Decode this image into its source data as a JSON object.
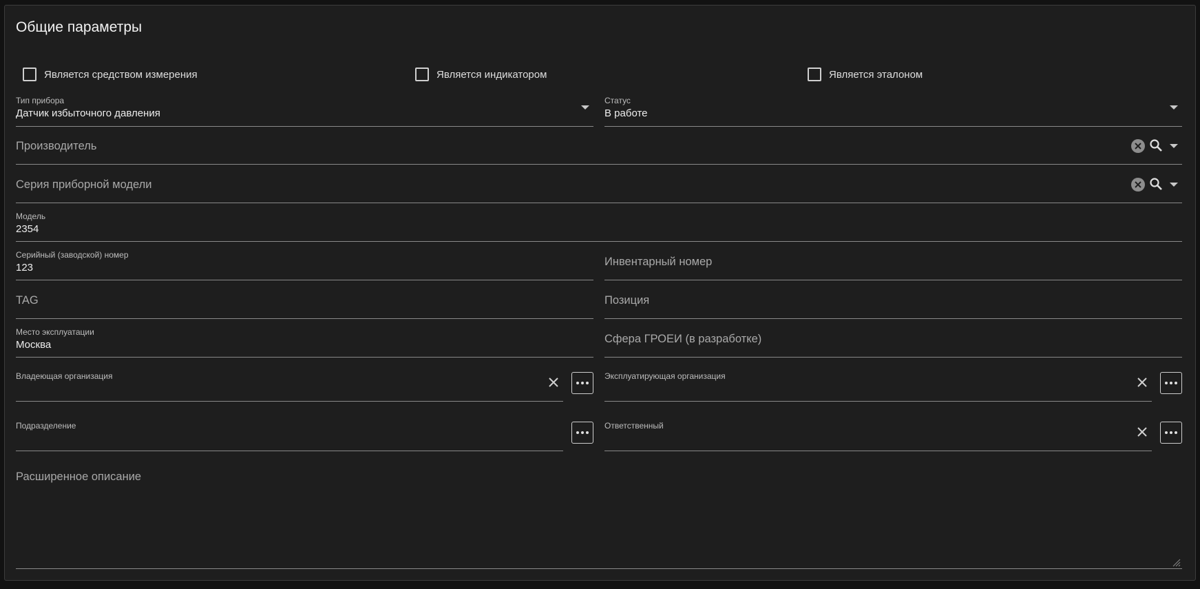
{
  "section": {
    "title": "Общие параметры"
  },
  "checkboxes": [
    {
      "label": "Является средством измерения",
      "checked": false
    },
    {
      "label": "Является индикатором",
      "checked": false
    },
    {
      "label": "Является эталоном",
      "checked": false
    }
  ],
  "fields": {
    "device_type": {
      "label": "Тип прибора",
      "value": "Датчик избыточного давления"
    },
    "status": {
      "label": "Статус",
      "value": "В работе"
    },
    "manufacturer": {
      "placeholder": "Производитель"
    },
    "model_series": {
      "placeholder": "Серия приборной модели"
    },
    "model": {
      "label": "Модель",
      "value": "2354"
    },
    "serial_number": {
      "label": "Серийный (заводской) номер",
      "value": "123"
    },
    "inventory_number": {
      "placeholder": "Инвентарный номер"
    },
    "tag": {
      "placeholder": "TAG"
    },
    "position": {
      "placeholder": "Позиция"
    },
    "operation_place": {
      "label": "Место эксплуатации",
      "value": "Москва"
    },
    "groei_sphere": {
      "placeholder": "Сфера ГРОЕИ (в разработке)"
    },
    "owner_org": {
      "label": "Владеющая организация",
      "value": ""
    },
    "operating_org": {
      "label": "Эксплуатирующая организация",
      "value": ""
    },
    "department": {
      "label": "Подразделение",
      "value": ""
    },
    "responsible": {
      "label": "Ответственный",
      "value": ""
    },
    "extended_description": {
      "placeholder": "Расширенное описание"
    }
  },
  "icons": {
    "dropdown": "chevron-down-icon",
    "clear": "clear-circle-icon",
    "search": "search-icon",
    "clear_x": "close-icon",
    "more": "more-horizontal-icon"
  },
  "colors": {
    "background": "#121212",
    "panel": "#1e1e1e",
    "text": "#e6e6e6",
    "muted": "#a9a9a9"
  }
}
